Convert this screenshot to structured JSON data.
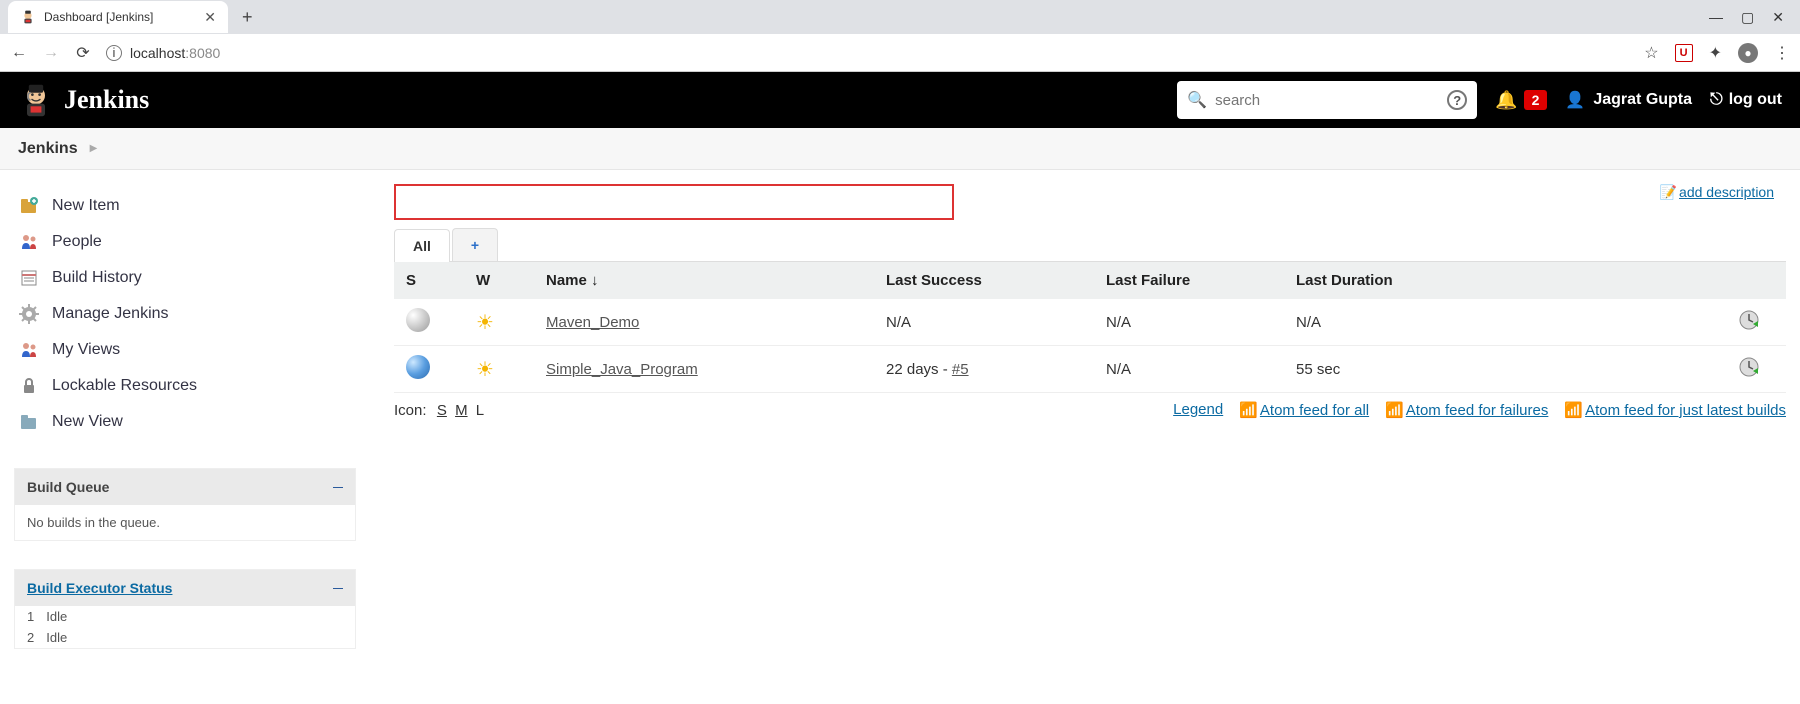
{
  "browser": {
    "tab_title": "Dashboard [Jenkins]",
    "url_host": "localhost",
    "url_port": ":8080"
  },
  "header": {
    "brand": "Jenkins",
    "search_placeholder": "search",
    "notification_count": "2",
    "username": "Jagrat Gupta",
    "logout": "log out"
  },
  "breadcrumb": {
    "root": "Jenkins"
  },
  "sidebar": {
    "tasks": [
      {
        "label": "New Item"
      },
      {
        "label": "People"
      },
      {
        "label": "Build History"
      },
      {
        "label": "Manage Jenkins"
      },
      {
        "label": "My Views"
      },
      {
        "label": "Lockable Resources"
      },
      {
        "label": "New View"
      }
    ],
    "build_queue": {
      "title": "Build Queue",
      "empty_text": "No builds in the queue."
    },
    "executors": {
      "title": "Build Executor Status",
      "rows": [
        {
          "num": "1",
          "status": "Idle"
        },
        {
          "num": "2",
          "status": "Idle"
        }
      ]
    }
  },
  "main": {
    "add_description": "add description",
    "tabs": {
      "all": "All",
      "plus": "+"
    },
    "columns": {
      "s": "S",
      "w": "W",
      "name": "Name  ↓",
      "last_success": "Last Success",
      "last_failure": "Last Failure",
      "last_duration": "Last Duration"
    },
    "jobs": [
      {
        "ball": "grey",
        "name": "Maven_Demo",
        "last_success": "N/A",
        "last_success_build": "",
        "last_failure": "N/A",
        "last_duration": "N/A"
      },
      {
        "ball": "blue",
        "name": "Simple_Java_Program",
        "last_success": "22 days - ",
        "last_success_build": "#5",
        "last_failure": "N/A",
        "last_duration": "55 sec"
      }
    ],
    "icon_size": {
      "label": "Icon:",
      "s": "S",
      "m": "M",
      "l": "L"
    },
    "footer_links": {
      "legend": "Legend",
      "feed_all": "Atom feed for all",
      "feed_fail": "Atom feed for failures",
      "feed_latest": "Atom feed for just latest builds"
    }
  }
}
